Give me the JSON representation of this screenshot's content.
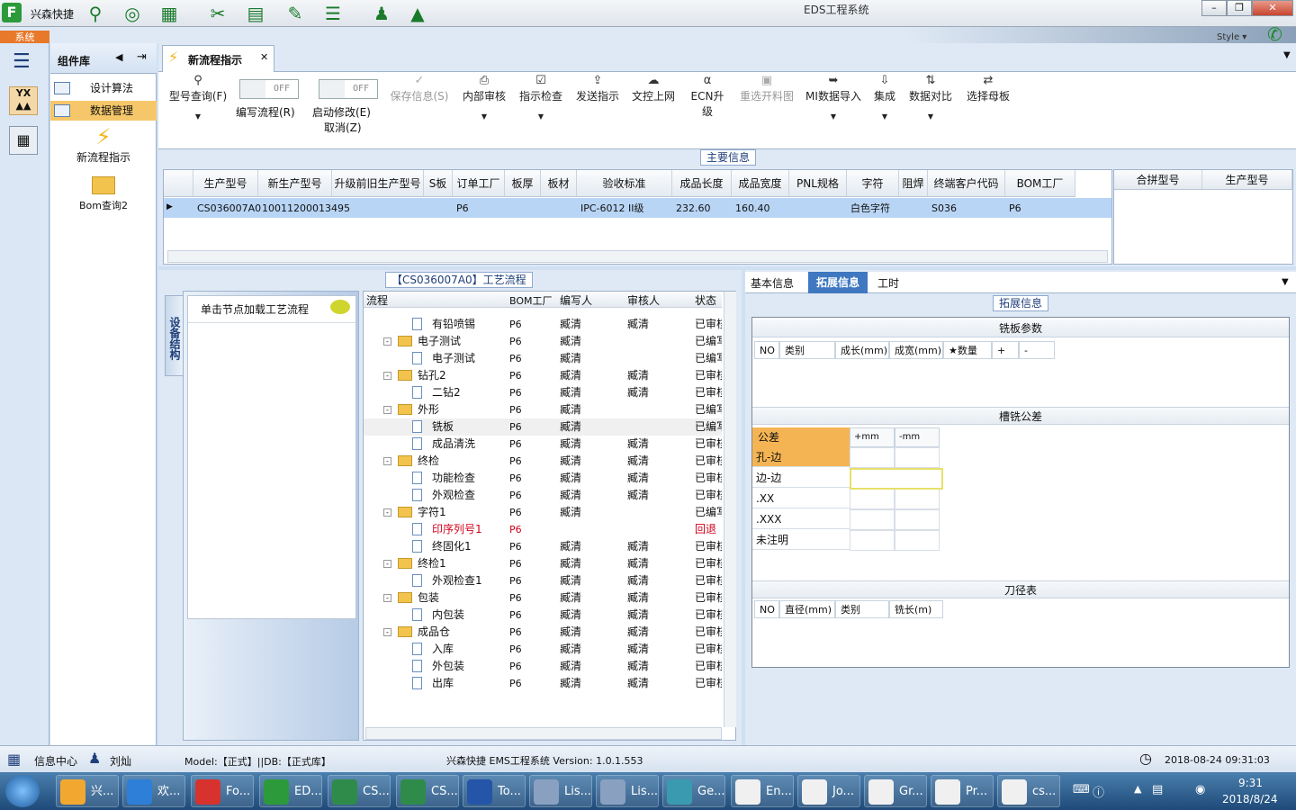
{
  "titlebar": {
    "app_name": "兴森快捷",
    "window_title": "EDS工程系统",
    "style_label": "Style"
  },
  "system_tab": "系统",
  "component_panel": {
    "title": "组件库",
    "items": [
      {
        "label": "设计算法"
      },
      {
        "label": "数据管理"
      }
    ],
    "big_items": [
      {
        "label": "新流程指示"
      },
      {
        "label": "Bom查询2"
      }
    ]
  },
  "doc_tab": {
    "label": "新流程指示"
  },
  "toolbar": {
    "model_query": "型号查询(F)",
    "edit_flow": "编写流程(R)",
    "start_modify": "启动修改(E)",
    "cancel": "取消(Z)",
    "toggle_off": "OFF",
    "save_info": "保存信息(S)",
    "internal_review": "内部审核",
    "instruction_check": "指示检查",
    "send_instruction": "发送指示",
    "doc_upload": "文控上网",
    "ecn_upgrade": "ECN升级",
    "reselect_cut": "重选开料图",
    "mi_import": "MI数据导入",
    "integrate": "集成",
    "data_compare": "数据对比",
    "select_board": "选择母板"
  },
  "main_info": {
    "title": "主要信息",
    "columns": [
      "生产型号",
      "新生产型号",
      "升级前旧生产型号",
      "S板",
      "订单工厂",
      "板厚",
      "板材",
      "验收标准",
      "成品长度",
      "成品宽度",
      "PNL规格",
      "字符",
      "阻焊",
      "终端客户代码",
      "BOM工厂"
    ],
    "row": [
      "CS036007A0",
      "10011200013495",
      "",
      "",
      "P6",
      "",
      "",
      "IPC-6012 II级",
      "232.60",
      "160.40",
      "",
      "白色字符",
      "",
      "S036",
      "P6"
    ],
    "side_columns": [
      "合拼型号",
      "生产型号"
    ]
  },
  "flow_panel": {
    "title": "【CS036007A0】工艺流程",
    "side_tab": "设备结构",
    "node_hint": "单击节点加载工艺流程",
    "headers": [
      "流程",
      "BOM工厂",
      "编写人",
      "审核人",
      "状态"
    ],
    "rows": [
      {
        "name": "有铅喷锡",
        "level": 1,
        "folder": false,
        "bom": "P6",
        "writer": "臧清",
        "reviewer": "臧清",
        "status": "已审核",
        "red": false
      },
      {
        "name": "电子测试",
        "level": 0,
        "folder": true,
        "bom": "P6",
        "writer": "臧清",
        "reviewer": "",
        "status": "已编写",
        "red": false
      },
      {
        "name": "电子测试",
        "level": 1,
        "folder": false,
        "bom": "P6",
        "writer": "臧清",
        "reviewer": "",
        "status": "已编写",
        "red": false
      },
      {
        "name": "钻孔2",
        "level": 0,
        "folder": true,
        "bom": "P6",
        "writer": "臧清",
        "reviewer": "臧清",
        "status": "已审核",
        "red": false
      },
      {
        "name": "二钻2",
        "level": 1,
        "folder": false,
        "bom": "P6",
        "writer": "臧清",
        "reviewer": "臧清",
        "status": "已审核",
        "red": false
      },
      {
        "name": "外形",
        "level": 0,
        "folder": true,
        "bom": "P6",
        "writer": "臧清",
        "reviewer": "",
        "status": "已编写",
        "red": false
      },
      {
        "name": "铣板",
        "level": 1,
        "folder": false,
        "bom": "P6",
        "writer": "臧清",
        "reviewer": "",
        "status": "已编写",
        "red": false
      },
      {
        "name": "成品清洗",
        "level": 1,
        "folder": false,
        "bom": "P6",
        "writer": "臧清",
        "reviewer": "臧清",
        "status": "已审核",
        "red": false
      },
      {
        "name": "终检",
        "level": 0,
        "folder": true,
        "bom": "P6",
        "writer": "臧清",
        "reviewer": "臧清",
        "status": "已审核",
        "red": false
      },
      {
        "name": "功能检查",
        "level": 1,
        "folder": false,
        "bom": "P6",
        "writer": "臧清",
        "reviewer": "臧清",
        "status": "已审核",
        "red": false
      },
      {
        "name": "外观检查",
        "level": 1,
        "folder": false,
        "bom": "P6",
        "writer": "臧清",
        "reviewer": "臧清",
        "status": "已审核",
        "red": false
      },
      {
        "name": "字符1",
        "level": 0,
        "folder": true,
        "bom": "P6",
        "writer": "臧清",
        "reviewer": "",
        "status": "已编写",
        "red": false
      },
      {
        "name": "印序列号1",
        "level": 1,
        "folder": false,
        "bom": "P6",
        "writer": "",
        "reviewer": "",
        "status": "回退",
        "red": true
      },
      {
        "name": "终固化1",
        "level": 1,
        "folder": false,
        "bom": "P6",
        "writer": "臧清",
        "reviewer": "臧清",
        "status": "已审核",
        "red": false
      },
      {
        "name": "终检1",
        "level": 0,
        "folder": true,
        "bom": "P6",
        "writer": "臧清",
        "reviewer": "臧清",
        "status": "已审核",
        "red": false
      },
      {
        "name": "外观检查1",
        "level": 1,
        "folder": false,
        "bom": "P6",
        "writer": "臧清",
        "reviewer": "臧清",
        "status": "已审核",
        "red": false
      },
      {
        "name": "包装",
        "level": 0,
        "folder": true,
        "bom": "P6",
        "writer": "臧清",
        "reviewer": "臧清",
        "status": "已审核",
        "red": false
      },
      {
        "name": "内包装",
        "level": 1,
        "folder": false,
        "bom": "P6",
        "writer": "臧清",
        "reviewer": "臧清",
        "status": "已审核",
        "red": false
      },
      {
        "name": "成品仓",
        "level": 0,
        "folder": true,
        "bom": "P6",
        "writer": "臧清",
        "reviewer": "臧清",
        "status": "已审核",
        "red": false
      },
      {
        "name": "入库",
        "level": 1,
        "folder": false,
        "bom": "P6",
        "writer": "臧清",
        "reviewer": "臧清",
        "status": "已审核",
        "red": false
      },
      {
        "name": "外包装",
        "level": 1,
        "folder": false,
        "bom": "P6",
        "writer": "臧清",
        "reviewer": "臧清",
        "status": "已审核",
        "red": false
      },
      {
        "name": "出库",
        "level": 1,
        "folder": false,
        "bom": "P6",
        "writer": "臧清",
        "reviewer": "臧清",
        "status": "已审核",
        "red": false
      }
    ]
  },
  "right_panel": {
    "tabs": [
      "基本信息",
      "拓展信息",
      "工时"
    ],
    "ext_title": "拓展信息",
    "mill_title": "铣板参数",
    "mill_headers": [
      "NO",
      "类别",
      "成长(mm)",
      "成宽(mm)",
      "★数量",
      "+",
      "-"
    ],
    "tol_title": "槽铣公差",
    "tol_headers": [
      "公差",
      "+mm",
      "-mm"
    ],
    "tol_rows": [
      "孔-边",
      "边-边",
      ".XX",
      ".XXX",
      "未注明"
    ],
    "tool_title": "刀径表",
    "tool_headers": [
      "NO",
      "直径(mm)",
      "类别",
      "铣长(m)"
    ]
  },
  "statusbar": {
    "info_center": "信息中心",
    "user": "刘灿",
    "model_db": "Model:【正式】||DB:【正式库】",
    "version": "兴森快捷 EMS工程系统 Version: 1.0.1.553",
    "datetime": "2018-08-24 09:31:03"
  },
  "taskbar": {
    "items": [
      "兴...",
      "欢...",
      "Fo...",
      "ED...",
      "CS...",
      "CS...",
      "To...",
      "Lis...",
      "Lis...",
      "Ge...",
      "En...",
      "Jo...",
      "Gr...",
      "Pr...",
      "cs..."
    ],
    "time": "9:31",
    "date": "2018/8/24"
  },
  "colors": {
    "accent_orange": "#f6c76a",
    "header_blue": "#1f3f7a",
    "selection_blue": "#b9d5f5",
    "red_status": "#d0021b",
    "tolerance_orange": "#f5b454"
  }
}
